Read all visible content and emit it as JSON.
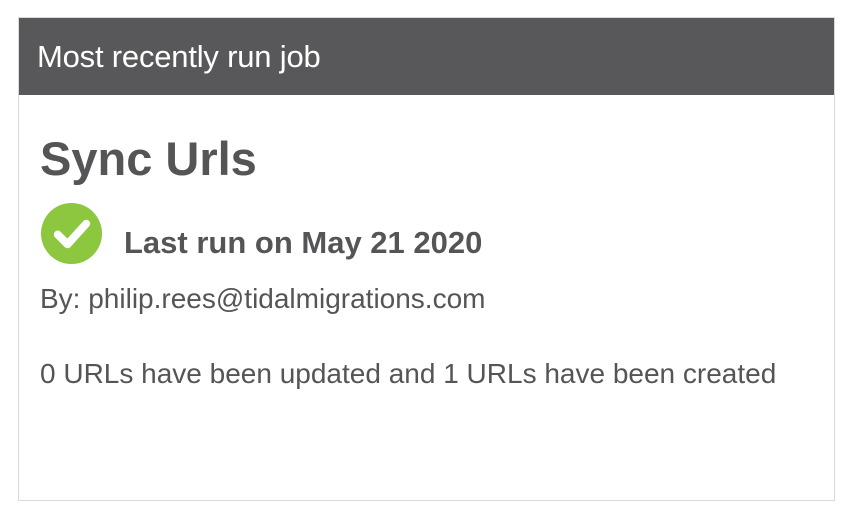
{
  "card": {
    "header_title": "Most recently run job"
  },
  "job": {
    "name": "Sync Urls",
    "status_icon": "check-circle-icon",
    "status_color": "#8dc63f",
    "last_run_text": "Last run on May 21 2020",
    "by_text": "By: philip.rees@tidalmigrations.com",
    "summary_text": "0 URLs have been updated and 1 URLs have been created"
  },
  "colors": {
    "header_background": "#58585a",
    "text": "#555557",
    "border": "#d9d9d9"
  }
}
